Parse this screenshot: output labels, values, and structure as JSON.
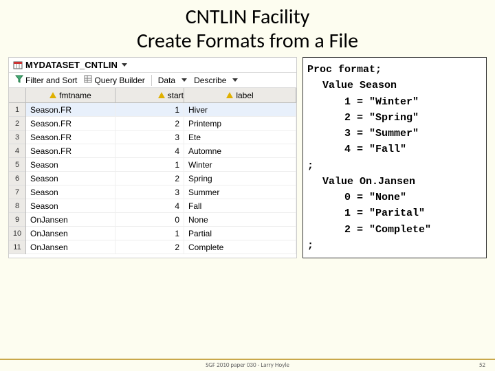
{
  "title_line1": "CNTLIN Facility",
  "title_line2": "Create Formats from a File",
  "dataset_name": "MYDATASET_CNTLIN",
  "toolbar": {
    "filter_sort": "Filter and Sort",
    "query_builder": "Query Builder",
    "data": "Data",
    "describe": "Describe"
  },
  "columns": {
    "fmtname": "fmtname",
    "start": "start",
    "label": "label"
  },
  "rownums": [
    "1",
    "2",
    "3",
    "4",
    "5",
    "6",
    "7",
    "8",
    "9",
    "10",
    "11"
  ],
  "rows": [
    {
      "fmtname": "Season.FR",
      "start": "1",
      "label": "Hiver"
    },
    {
      "fmtname": "Season.FR",
      "start": "2",
      "label": "Printemp"
    },
    {
      "fmtname": "Season.FR",
      "start": "3",
      "label": "Ete"
    },
    {
      "fmtname": "Season.FR",
      "start": "4",
      "label": "Automne"
    },
    {
      "fmtname": "Season",
      "start": "1",
      "label": "Winter"
    },
    {
      "fmtname": "Season",
      "start": "2",
      "label": "Spring"
    },
    {
      "fmtname": "Season",
      "start": "3",
      "label": "Summer"
    },
    {
      "fmtname": "Season",
      "start": "4",
      "label": "Fall"
    },
    {
      "fmtname": "OnJansen",
      "start": "0",
      "label": "None"
    },
    {
      "fmtname": "OnJansen",
      "start": "1",
      "label": "Partial"
    },
    {
      "fmtname": "OnJansen",
      "start": "2",
      "label": "Complete"
    }
  ],
  "code": {
    "l1": "Proc format;",
    "l2": "Value Season",
    "l3": "1 = \"Winter\"",
    "l4": "2 = \"Spring\"",
    "l5": "3 = \"Summer\"",
    "l6": "4 = \"Fall\"",
    "semi1": ";",
    "l7": "Value On.Jansen",
    "l8": "0 = \"None\"",
    "l9": "1 = \"Parital\"",
    "l10": "2 = \"Complete\"",
    "semi2": ";"
  },
  "footer": {
    "credit": "SGF 2010 paper 030 - Larry Hoyle",
    "page": "52"
  }
}
